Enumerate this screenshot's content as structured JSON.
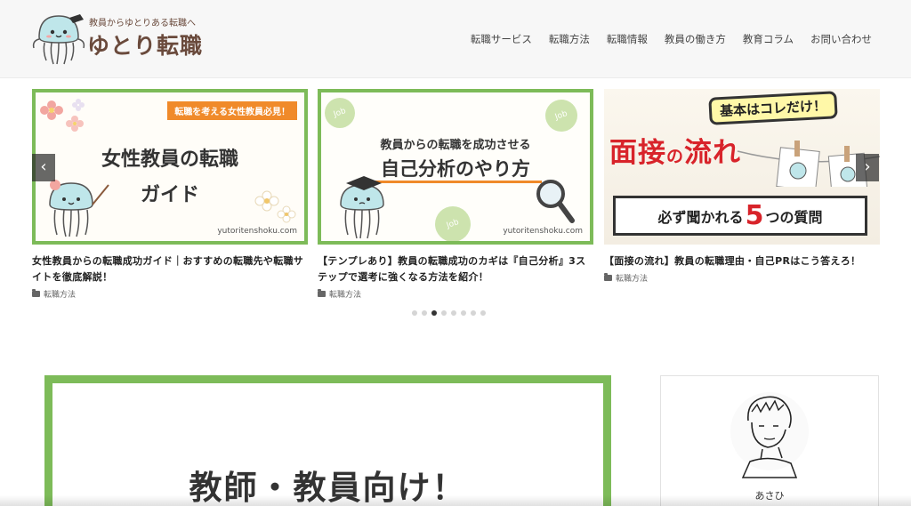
{
  "header": {
    "logo_tagline": "教員からゆとりある転職へ",
    "logo_name": "ゆとり転職",
    "nav": [
      {
        "label": "転職サービス"
      },
      {
        "label": "転職方法"
      },
      {
        "label": "転職情報"
      },
      {
        "label": "教員の働き方"
      },
      {
        "label": "教育コラム"
      },
      {
        "label": "お問い合わせ"
      }
    ]
  },
  "carousel": {
    "cards": [
      {
        "thumb_badge": "転職を考える女性教員必見！",
        "thumb_line1": "女性教員の転職",
        "thumb_line2": "ガイド",
        "thumb_url": "yutoritenshoku.com",
        "title": "女性教員からの転職成功ガイド｜おすすめの転職先や転職サイトを徹底解説！",
        "category": "転職方法"
      },
      {
        "thumb_sub": "教員からの転職を成功させる",
        "thumb_main": "自己分析のやり方",
        "thumb_url": "yutoritenshoku.com",
        "bubble_label": "Job",
        "title": "【テンプレあり】教員の転職成功のカギは『自己分析』3ステップで選考に強くなる方法を紹介！",
        "category": "転職方法"
      },
      {
        "thumb_top": "基本はコレだけ！",
        "thumb_main_a": "面接",
        "thumb_main_b": "の",
        "thumb_main_c": "流れ",
        "thumb_bottom_a": "必ず聞かれる",
        "thumb_bottom_num": "5",
        "thumb_bottom_b": "つの質問",
        "title": "【面接の流れ】教員の転職理由・自己PRはこう答えろ！",
        "category": "転職方法"
      }
    ],
    "prev_label": "‹",
    "next_label": "›",
    "dot_count": 8,
    "active_dot": 3
  },
  "feature": {
    "text": "教師・教員向け！"
  },
  "profile": {
    "name": "あさひ"
  },
  "colors": {
    "accent_green": "#7dbb59",
    "accent_orange": "#f08a2a",
    "accent_red": "#d8232a",
    "brand_brown": "#6a4a3c"
  }
}
